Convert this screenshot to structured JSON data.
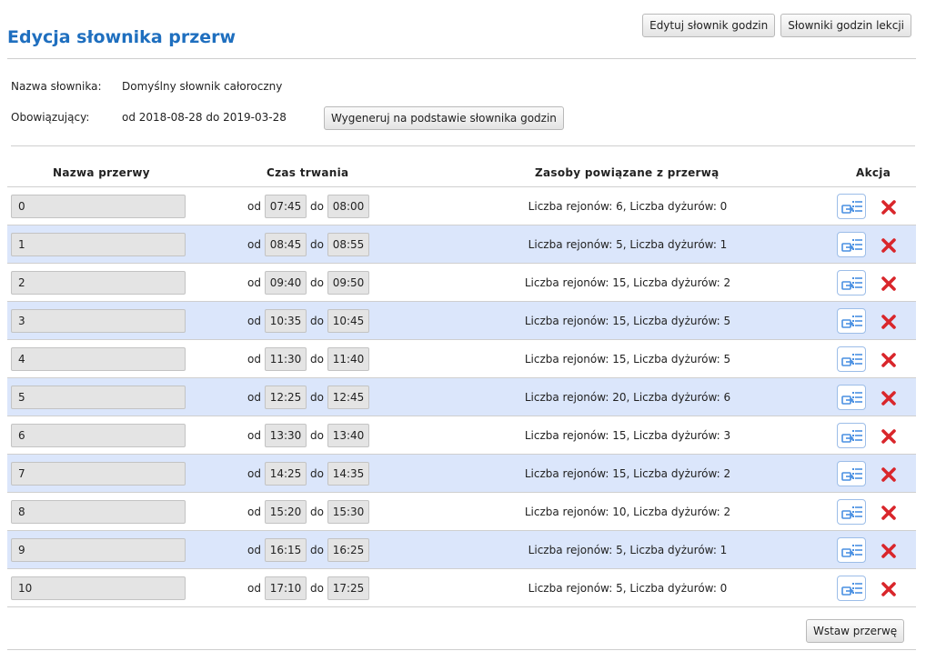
{
  "header": {
    "title": "Edycja słownika przerw",
    "edit_hours_label": "Edytuj słownik godzin",
    "hours_dicts_label": "Słowniki godzin lekcji"
  },
  "info": {
    "name_label": "Nazwa słownika:",
    "name_value": "Domyślny słownik całoroczny",
    "valid_label": "Obowiązujący:",
    "valid_value": "od 2018-08-28 do 2019-03-28",
    "generate_label": "Wygeneruj na podstawie słownika godzin"
  },
  "table": {
    "columns": {
      "name": "Nazwa przerwy",
      "duration": "Czas trwania",
      "resources": "Zasoby powiązane z przerwą",
      "action": "Akcja"
    },
    "from_label": "od",
    "to_label": "do",
    "rows": [
      {
        "name": "0",
        "from": "07:45",
        "to": "08:00",
        "resources": "Liczba rejonów: 6, Liczba dyżurów: 0"
      },
      {
        "name": "1",
        "from": "08:45",
        "to": "08:55",
        "resources": "Liczba rejonów: 5, Liczba dyżurów: 1"
      },
      {
        "name": "2",
        "from": "09:40",
        "to": "09:50",
        "resources": "Liczba rejonów: 15, Liczba dyżurów: 2"
      },
      {
        "name": "3",
        "from": "10:35",
        "to": "10:45",
        "resources": "Liczba rejonów: 15, Liczba dyżurów: 5"
      },
      {
        "name": "4",
        "from": "11:30",
        "to": "11:40",
        "resources": "Liczba rejonów: 15, Liczba dyżurów: 5"
      },
      {
        "name": "5",
        "from": "12:25",
        "to": "12:45",
        "resources": "Liczba rejonów: 20, Liczba dyżurów: 6"
      },
      {
        "name": "6",
        "from": "13:30",
        "to": "13:40",
        "resources": "Liczba rejonów: 15, Liczba dyżurów: 3"
      },
      {
        "name": "7",
        "from": "14:25",
        "to": "14:35",
        "resources": "Liczba rejonów: 15, Liczba dyżurów: 2"
      },
      {
        "name": "8",
        "from": "15:20",
        "to": "15:30",
        "resources": "Liczba rejonów: 10, Liczba dyżurów: 2"
      },
      {
        "name": "9",
        "from": "16:15",
        "to": "16:25",
        "resources": "Liczba rejonów: 5, Liczba dyżurów: 1"
      },
      {
        "name": "10",
        "from": "17:10",
        "to": "17:25",
        "resources": "Liczba rejonów: 5, Liczba dyżurów: 0"
      }
    ]
  },
  "footer": {
    "insert_label": "Wstaw przerwę"
  },
  "colors": {
    "title": "#1f6fbf",
    "row_alt": "#dbe6fb",
    "delete": "#d9262b",
    "edit_icon": "#4a90e2"
  }
}
